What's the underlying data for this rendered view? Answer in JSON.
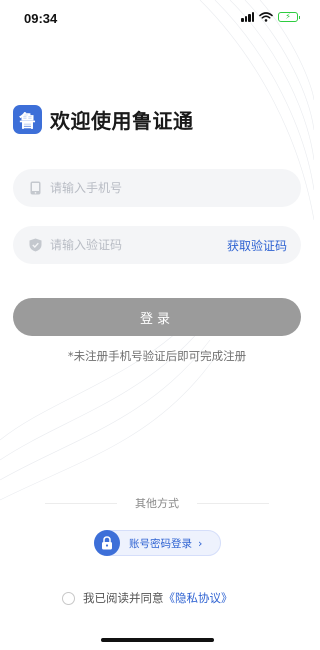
{
  "status_bar": {
    "time": "09:34"
  },
  "app": {
    "title": "欢迎使用鲁证通",
    "logo_char": "鲁"
  },
  "phone_field": {
    "placeholder": "请输入手机号",
    "value": "",
    "icon": "phone-icon"
  },
  "code_field": {
    "placeholder": "请输入验证码",
    "value": "",
    "icon": "shield-icon",
    "get_code_label": "获取验证码"
  },
  "login_button": {
    "label": "登录"
  },
  "hint": "*未注册手机号验证后即可完成注册",
  "other_methods": {
    "label": "其他方式",
    "account_login": {
      "label": "账号密码登录",
      "icon": "lock-icon",
      "chevron": "›"
    }
  },
  "agreement": {
    "prefix": "我已阅读并同意",
    "link": "《隐私协议》"
  },
  "colors": {
    "accent": "#2f63d2",
    "logo_bg": "#3d6fd8",
    "button_disabled": "#9b9b9b"
  }
}
